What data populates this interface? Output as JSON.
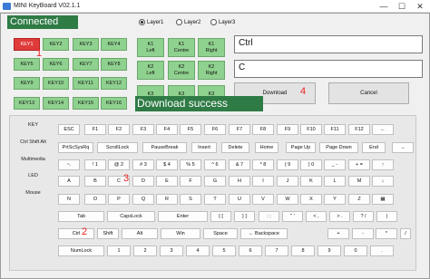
{
  "window": {
    "title": "MINI KeyBoard V02.1.1",
    "controls": [
      "—",
      "☐",
      "✕"
    ]
  },
  "status": {
    "connected": "Connected",
    "download_success": "Download success"
  },
  "keys_grid": [
    [
      "KEY1",
      "KEY2",
      "KEY3",
      "KEY4"
    ],
    [
      "KEY5",
      "KEY6",
      "KEY7",
      "KEY8"
    ],
    [
      "KEY9",
      "KEY10",
      "KEY11",
      "KEY12"
    ],
    [
      "KEY13",
      "KEY14",
      "KEY15",
      "KEY16"
    ]
  ],
  "selected_key": "KEY1",
  "knobs": [
    [
      [
        "K1",
        "Left"
      ],
      [
        "K1",
        "Centre"
      ],
      [
        "K1",
        "Right"
      ]
    ],
    [
      [
        "K2",
        "Left"
      ],
      [
        "K2",
        "Centre"
      ],
      [
        "K2",
        "Right"
      ]
    ],
    [
      [
        "K3",
        ""
      ],
      [
        "K3",
        ""
      ],
      [
        "K3",
        ""
      ]
    ]
  ],
  "layers": {
    "options": [
      "Layer1",
      "Layer2",
      "Layer3"
    ],
    "selected": "Layer1"
  },
  "fields": {
    "modifier": "Ctrl",
    "key": "C"
  },
  "buttons": {
    "download": "Download",
    "cancel": "Cancel"
  },
  "annotations": {
    "n1": "1",
    "n2": "2",
    "n3": "3",
    "n4": "4"
  },
  "side_menu": [
    "KEY",
    "Ctrl Shift Alt",
    "Multimedia",
    "LED",
    "Mouse"
  ],
  "keyboard": {
    "row1": [
      "ESC",
      "F1",
      "F2",
      "F3",
      "F4",
      "F5",
      "F6",
      "F7",
      "F8",
      "F9",
      "F10",
      "F11",
      "F12",
      "←"
    ],
    "row2": [
      "PrtScSysRq",
      "ScrollLock",
      "PauseBreak",
      "Insert",
      "Delete",
      "Home",
      "Page Up",
      "Page Down",
      "End",
      "→"
    ],
    "row3": [
      "~.",
      "! 1",
      "@ 2",
      "# 3",
      "$ 4",
      "% 5",
      "^ 6",
      "& 7",
      "* 8",
      "( 9",
      ") 0",
      "_ -",
      "+ =",
      "↑"
    ],
    "row4": [
      "A",
      "B",
      "C",
      "D",
      "E",
      "F",
      "G",
      "H",
      "I",
      "J",
      "K",
      "L",
      "M",
      "↓"
    ],
    "row5": [
      "N",
      "O",
      "P",
      "Q",
      "R",
      "S",
      "T",
      "U",
      "V",
      "W",
      "X",
      "Y",
      "Z",
      "▦"
    ],
    "row6": [
      "Tab",
      "CapsLock",
      "Enter",
      "{ [",
      "} ]",
      ": ;",
      "\" '",
      "< ,",
      "> .",
      "? /",
      "|"
    ],
    "row7": [
      "Ctrl",
      "Shift",
      "Alt",
      "Win",
      "Space",
      "← Backspace",
      "+",
      "-",
      "*",
      "/"
    ],
    "row8": [
      "NumLock",
      "1",
      "2",
      "3",
      "4",
      "5",
      "6",
      "7",
      "8",
      "9",
      "0",
      "."
    ]
  }
}
